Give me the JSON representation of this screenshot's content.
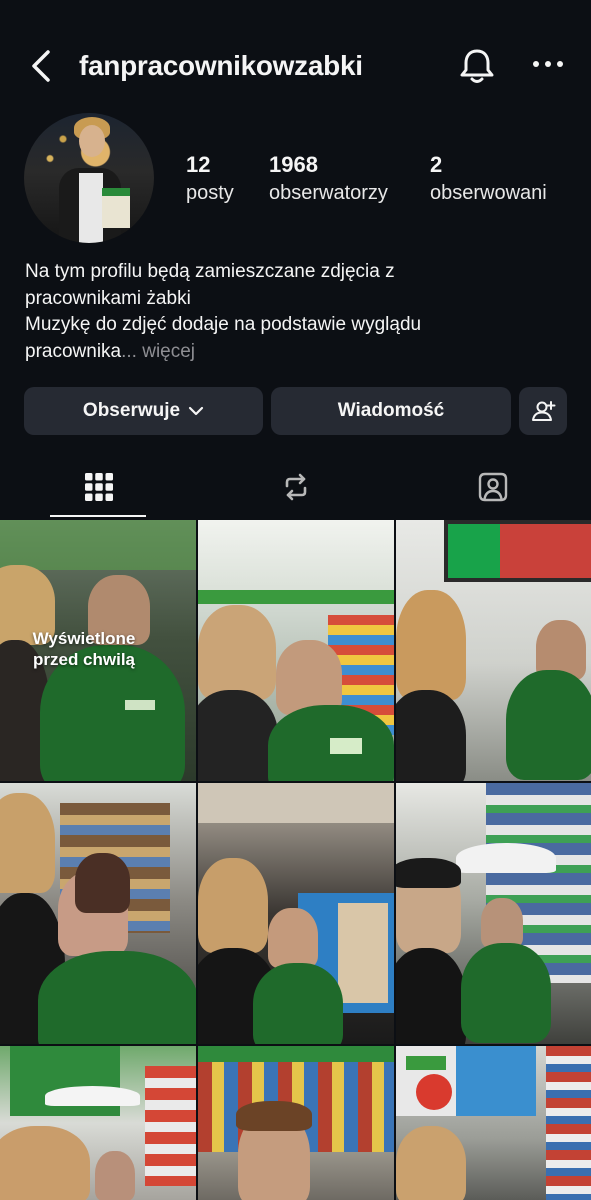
{
  "header": {
    "username": "fanpracownikowzabki",
    "back_icon": "chevron-left-icon",
    "bell_icon": "bell-icon",
    "more_icon": "ellipsis-icon"
  },
  "profile": {
    "stats": [
      {
        "value": "12",
        "label": "posty"
      },
      {
        "value": "1968",
        "label": "obserwatorzy"
      },
      {
        "value": "2",
        "label": "obserwowani"
      }
    ],
    "bio_lines": [
      "Na tym profilu będą zamieszczane zdjęcia z",
      "pracownikami żabki",
      "Muzykę do zdjęć dodaje na podstawie wyglądu",
      "pracownika"
    ],
    "bio_ellipsis": "...",
    "bio_more": "więcej"
  },
  "actions": {
    "follow_label": "Obserwuje",
    "message_label": "Wiadomość",
    "suggest_icon": "add-person-icon"
  },
  "tabs": [
    {
      "icon": "grid-icon",
      "active": true
    },
    {
      "icon": "repost-icon",
      "active": false
    },
    {
      "icon": "tagged-icon",
      "active": false
    }
  ],
  "posts": {
    "first_overlay": "Wyświetlone\nprzed chwilą"
  },
  "colors": {
    "background": "#0c0f14",
    "button": "#262a33",
    "zabka_green": "#1f7a2e",
    "muted": "#8e8e93"
  }
}
